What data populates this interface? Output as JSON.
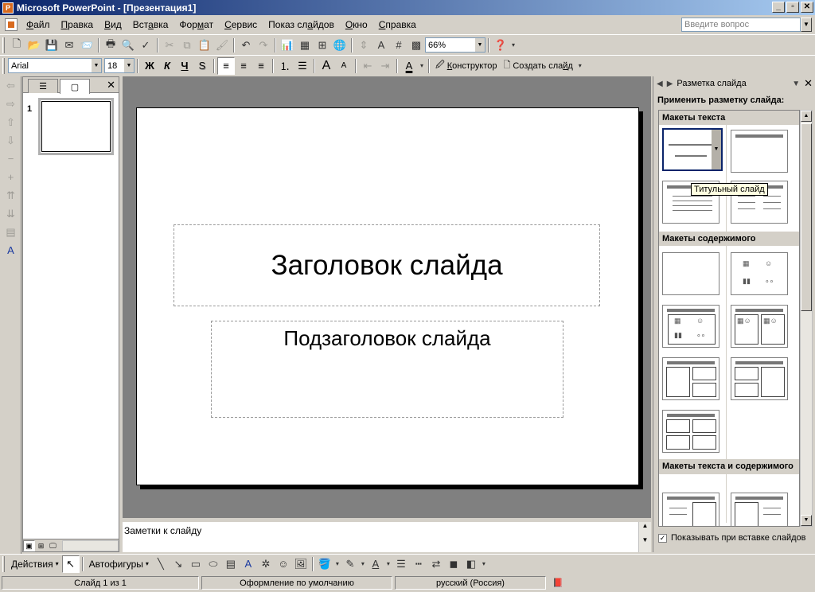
{
  "window": {
    "title": "Microsoft PowerPoint - [Презентация1]",
    "minimize": "_",
    "restore": "▫",
    "close": "✕"
  },
  "menu": {
    "items": [
      {
        "accel": "Ф",
        "rest": "айл"
      },
      {
        "accel": "П",
        "rest": "равка"
      },
      {
        "accel": "В",
        "rest": "ид"
      },
      {
        "accel": "",
        "pre": "Вст",
        "accel2": "а",
        "rest": "вка"
      },
      {
        "accel": "",
        "pre": "Фор",
        "accel2": "м",
        "rest": "ат"
      },
      {
        "accel": "С",
        "rest": "ервис"
      },
      {
        "accel": "",
        "pre": "Показ сл",
        "accel2": "а",
        "rest": "йдов"
      },
      {
        "accel": "О",
        "rest": "кно"
      },
      {
        "accel": "С",
        "rest": "правка"
      }
    ],
    "ask_placeholder": "Введите вопрос"
  },
  "standard_toolbar": {
    "zoom": "66%"
  },
  "formatting_toolbar": {
    "font": "Arial",
    "size": "18",
    "bold": "Ж",
    "italic": "К",
    "underline": "Ч",
    "shadow": "S",
    "designer_accel": "К",
    "designer_rest": "онструктор",
    "new_slide_pre": "Создать сла",
    "new_slide_accel": "й",
    "new_slide_rest": "д"
  },
  "slides_pane": {
    "slide_number": "1"
  },
  "slide": {
    "title": "Заголовок слайда",
    "subtitle": "Подзаголовок слайда"
  },
  "notes": {
    "placeholder": "Заметки к слайду"
  },
  "task_pane": {
    "title": "Разметка слайда",
    "apply_label": "Применить разметку слайда:",
    "sections": {
      "text": "Макеты текста",
      "content": "Макеты содержимого",
      "text_content": "Макеты текста и содержимого"
    },
    "tooltip": "Титульный слайд",
    "show_on_insert": "Показывать при вставке слайдов",
    "show_on_insert_checked": true
  },
  "drawing_toolbar": {
    "actions": "Действия",
    "autoshapes": "Автофигуры"
  },
  "status": {
    "slide": "Слайд 1 из 1",
    "design": "Оформление по умолчанию",
    "language": "русский (Россия)"
  }
}
